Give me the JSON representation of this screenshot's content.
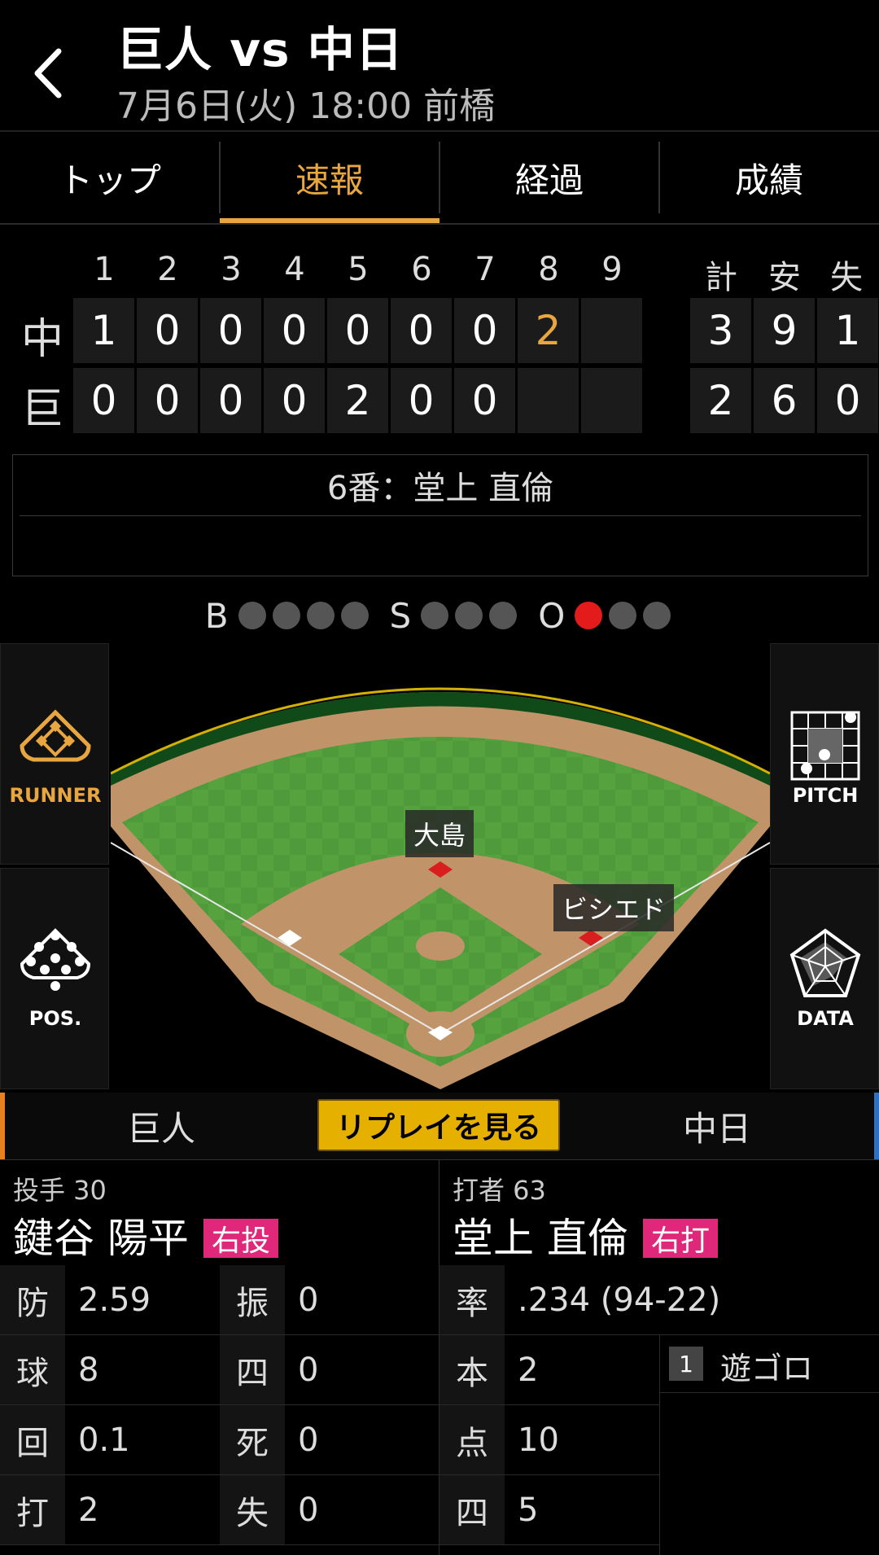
{
  "header": {
    "title": "巨人 vs 中日",
    "subtitle": "7月6日(火) 18:00 前橋"
  },
  "tabs": [
    {
      "label": "トップ",
      "active": false
    },
    {
      "label": "速報",
      "active": true
    },
    {
      "label": "経過",
      "active": false
    },
    {
      "label": "成績",
      "active": false
    }
  ],
  "scoreboard": {
    "innings": [
      "1",
      "2",
      "3",
      "4",
      "5",
      "6",
      "7",
      "8",
      "9"
    ],
    "totals_headers": [
      "計",
      "安",
      "失"
    ],
    "teams": [
      {
        "label": "中",
        "innings": [
          "1",
          "0",
          "0",
          "0",
          "0",
          "0",
          "0",
          "2",
          ""
        ],
        "totals": [
          "3",
          "9",
          "1"
        ]
      },
      {
        "label": "巨",
        "innings": [
          "0",
          "0",
          "0",
          "0",
          "2",
          "0",
          "0",
          "",
          ""
        ],
        "totals": [
          "2",
          "6",
          "0"
        ]
      }
    ]
  },
  "current_batter": "6番：堂上 直倫",
  "count": {
    "balls_label": "B",
    "balls": 0,
    "balls_max": 4,
    "strikes_label": "S",
    "strikes": 0,
    "strikes_max": 3,
    "outs_label": "O",
    "outs": 1,
    "outs_max": 3
  },
  "field": {
    "runner_second": "大島",
    "runner_first": "ビシエド",
    "buttons": {
      "runner": "RUNNER",
      "pitch": "PITCH",
      "pos": "POS.",
      "data": "DATA"
    }
  },
  "team_switch": {
    "left": "巨人",
    "replay": "リプレイを見る",
    "right": "中日"
  },
  "pitcher": {
    "role": "投手 30",
    "name": "鍵谷 陽平",
    "tag": "右投",
    "stats": [
      {
        "k1": "防",
        "v1": "2.59",
        "k2": "振",
        "v2": "0"
      },
      {
        "k1": "球",
        "v1": "8",
        "k2": "四",
        "v2": "0"
      },
      {
        "k1": "回",
        "v1": "0.1",
        "k2": "死",
        "v2": "0"
      },
      {
        "k1": "打",
        "v1": "2",
        "k2": "失",
        "v2": "0"
      }
    ]
  },
  "batter": {
    "role": "打者 63",
    "name": "堂上 直倫",
    "tag": "右打",
    "stats": [
      {
        "k": "率",
        "v": ".234 (94-22)"
      },
      {
        "k": "本",
        "v": "2"
      },
      {
        "k": "点",
        "v": "10"
      },
      {
        "k": "四",
        "v": "5"
      }
    ],
    "at_bats": [
      {
        "num": "1",
        "result": "遊ゴロ"
      }
    ]
  },
  "colors": {
    "accent": "#e8a640",
    "out_dot": "#e31b1b",
    "tag": "#e0287a",
    "replay": "#e6b000",
    "home_bar": "#e8801f",
    "away_bar": "#2f6fc4"
  }
}
